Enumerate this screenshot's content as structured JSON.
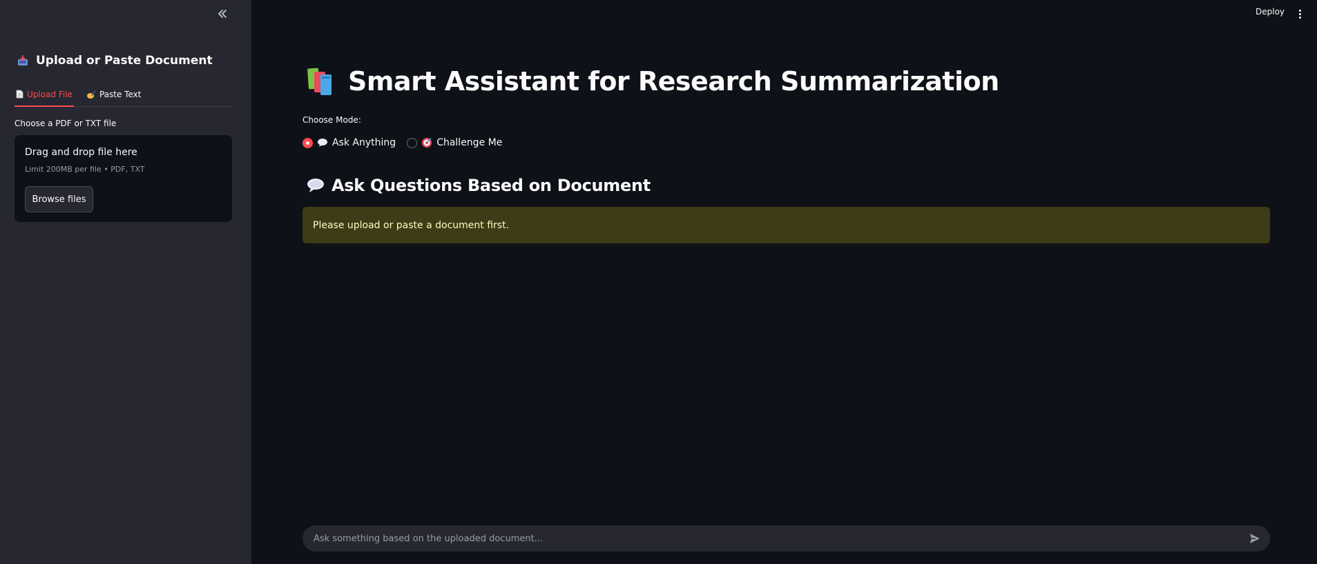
{
  "sidebar": {
    "collapse_icon": "double-chevron-left-icon",
    "header_icon": "inbox-tray-icon",
    "title": "Upload or Paste Document",
    "tabs": [
      {
        "icon": "page-icon",
        "label": "Upload File",
        "active": true
      },
      {
        "icon": "writing-hand-icon",
        "label": "Paste Text",
        "active": false
      }
    ],
    "file_label": "Choose a PDF or TXT file",
    "dropzone": {
      "title": "Drag and drop file here",
      "subtitle": "Limit 200MB per file • PDF, TXT",
      "button": "Browse files"
    }
  },
  "topbar": {
    "deploy": "Deploy",
    "menu_icon": "kebab-menu-icon"
  },
  "main": {
    "title_icon": "books-icon",
    "title": "Smart Assistant for Research Summarization",
    "mode_label": "Choose Mode:",
    "modes": [
      {
        "icon": "speech-bubble-icon",
        "label": "Ask Anything",
        "selected": true
      },
      {
        "icon": "target-icon",
        "label": "Challenge Me",
        "selected": false
      }
    ],
    "section_icon": "speech-bubble-icon",
    "section_title": "Ask Questions Based on Document",
    "warning": "Please upload or paste a document first."
  },
  "chat": {
    "placeholder": "Ask something based on the uploaded document...",
    "send_icon": "send-icon"
  },
  "colors": {
    "background": "#0e1117",
    "sidebar": "#262730",
    "accent": "#ff4b4b",
    "warning_bg": "#3e3b16",
    "warning_text": "#fffbc3"
  }
}
